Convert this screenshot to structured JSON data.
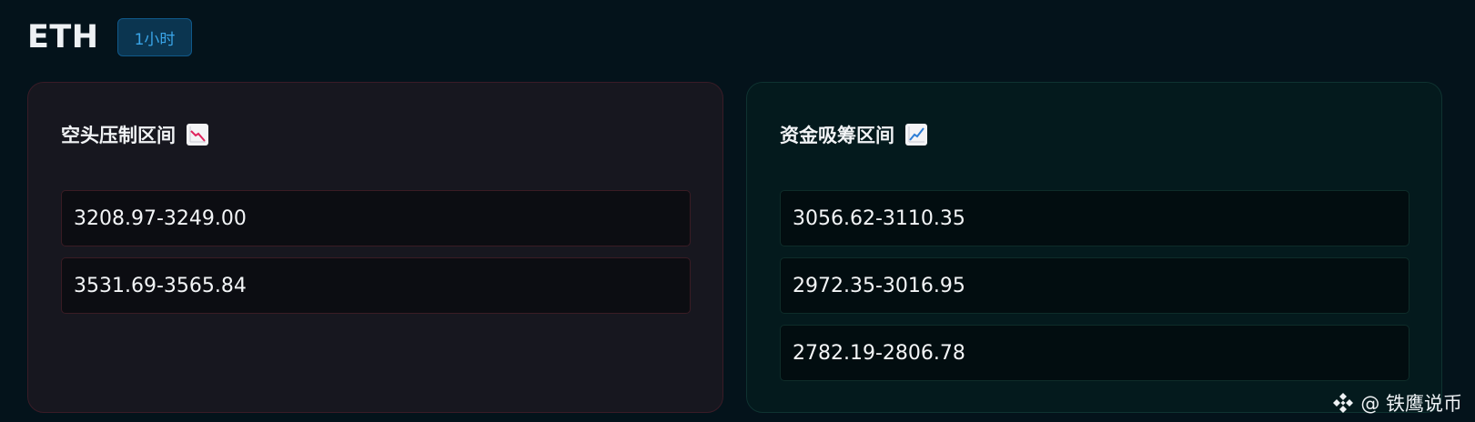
{
  "header": {
    "symbol": "ETH",
    "timeframe": "1小时"
  },
  "short_panel": {
    "title": "空头压制区间",
    "icon": "chart-decreasing-icon",
    "ranges": [
      "3208.97-3249.00",
      "3531.69-3565.84"
    ]
  },
  "long_panel": {
    "title": "资金吸筹区间",
    "icon": "chart-increasing-icon",
    "ranges": [
      "3056.62-3110.35",
      "2972.35-3016.95",
      "2782.19-2806.78"
    ]
  },
  "watermark": {
    "text": "@ 铁鹰说币",
    "logo": "binance-logo-icon"
  },
  "colors": {
    "background": "#04131b",
    "short_panel_bg": "#17171f",
    "long_panel_bg": "#041a1d",
    "badge_text": "#3aa5e8",
    "trend_down": "#e0245e",
    "trend_up": "#2f7fd6"
  }
}
